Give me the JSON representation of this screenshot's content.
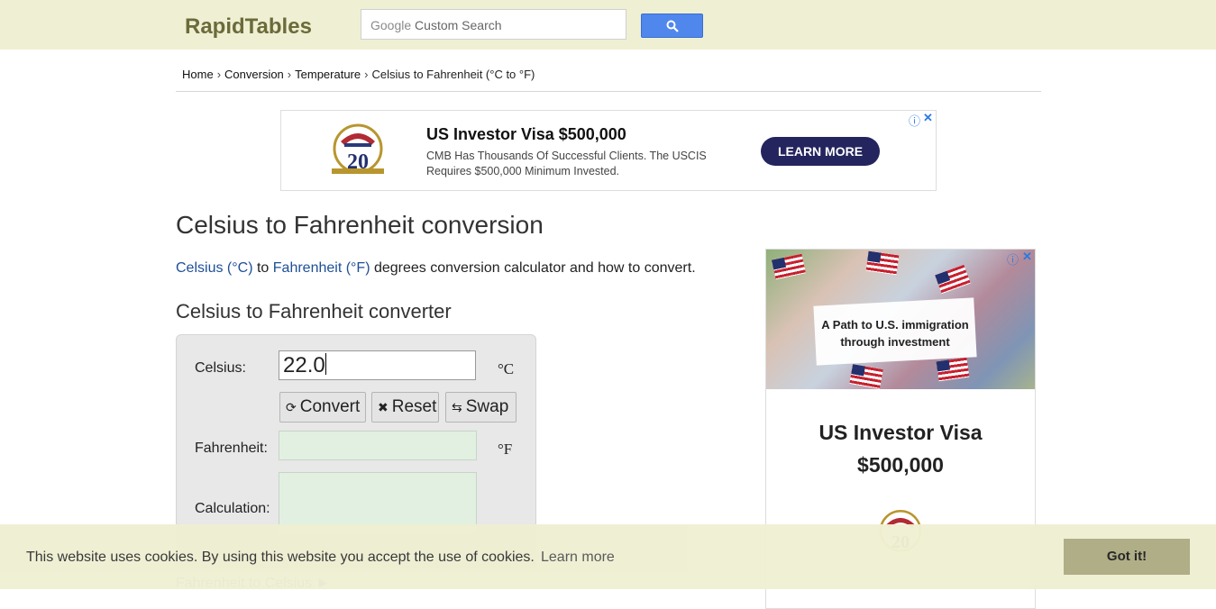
{
  "header": {
    "logo": "RapidTables",
    "search": {
      "google": "Google",
      "placeholder": "Custom Search"
    }
  },
  "breadcrumb": [
    "Home",
    "Conversion",
    "Temperature",
    "Celsius to Fahrenheit (°C to °F)"
  ],
  "ad_top": {
    "medal_number": "20",
    "title": "US Investor Visa $500,000",
    "description": "CMB Has Thousands Of Successful Clients. The USCIS Requires $500,000 Minimum Invested.",
    "cta": "LEARN MORE"
  },
  "main": {
    "title": "Celsius to Fahrenheit conversion",
    "intro": {
      "link1": "Celsius (°C)",
      "to": "to",
      "link2": "Fahrenheit (°F)",
      "rest": "degrees conversion calculator and how to convert."
    },
    "converter_heading": "Celsius to Fahrenheit converter",
    "converter": {
      "celsius_label": "Celsius:",
      "celsius_value": "22.0",
      "celsius_unit": "°C",
      "convert_label": "Convert",
      "reset_label": "Reset",
      "swap_label": "Swap",
      "fahrenheit_label": "Fahrenheit:",
      "fahrenheit_unit": "°F",
      "calculation_label": "Calculation:"
    },
    "next_link": "Fahrenheit to Celsius ►"
  },
  "ad_side": {
    "banner_text": "A Path to U.S. immigration through investment",
    "headline_line1": "US Investor Visa",
    "headline_line2": "$500,000",
    "medal_number": "20"
  },
  "cookie": {
    "message": "This website uses cookies. By using this website you accept the use of cookies.",
    "learn_more": "Learn more",
    "button": "Got it!"
  },
  "colors": {
    "header_bg": "#efefd3",
    "logo": "#6b6b3a",
    "link": "#1e4f97",
    "search_button": "#4f87ec",
    "ad_cta": "#24245e",
    "result_field": "#e2f0e2",
    "cookie_button": "#adac83"
  },
  "icons": [
    "search-icon",
    "refresh-icon",
    "close-icon",
    "swap-icon",
    "ad-info-icon",
    "ad-close-icon",
    "medal-icon",
    "flag-icon"
  ]
}
